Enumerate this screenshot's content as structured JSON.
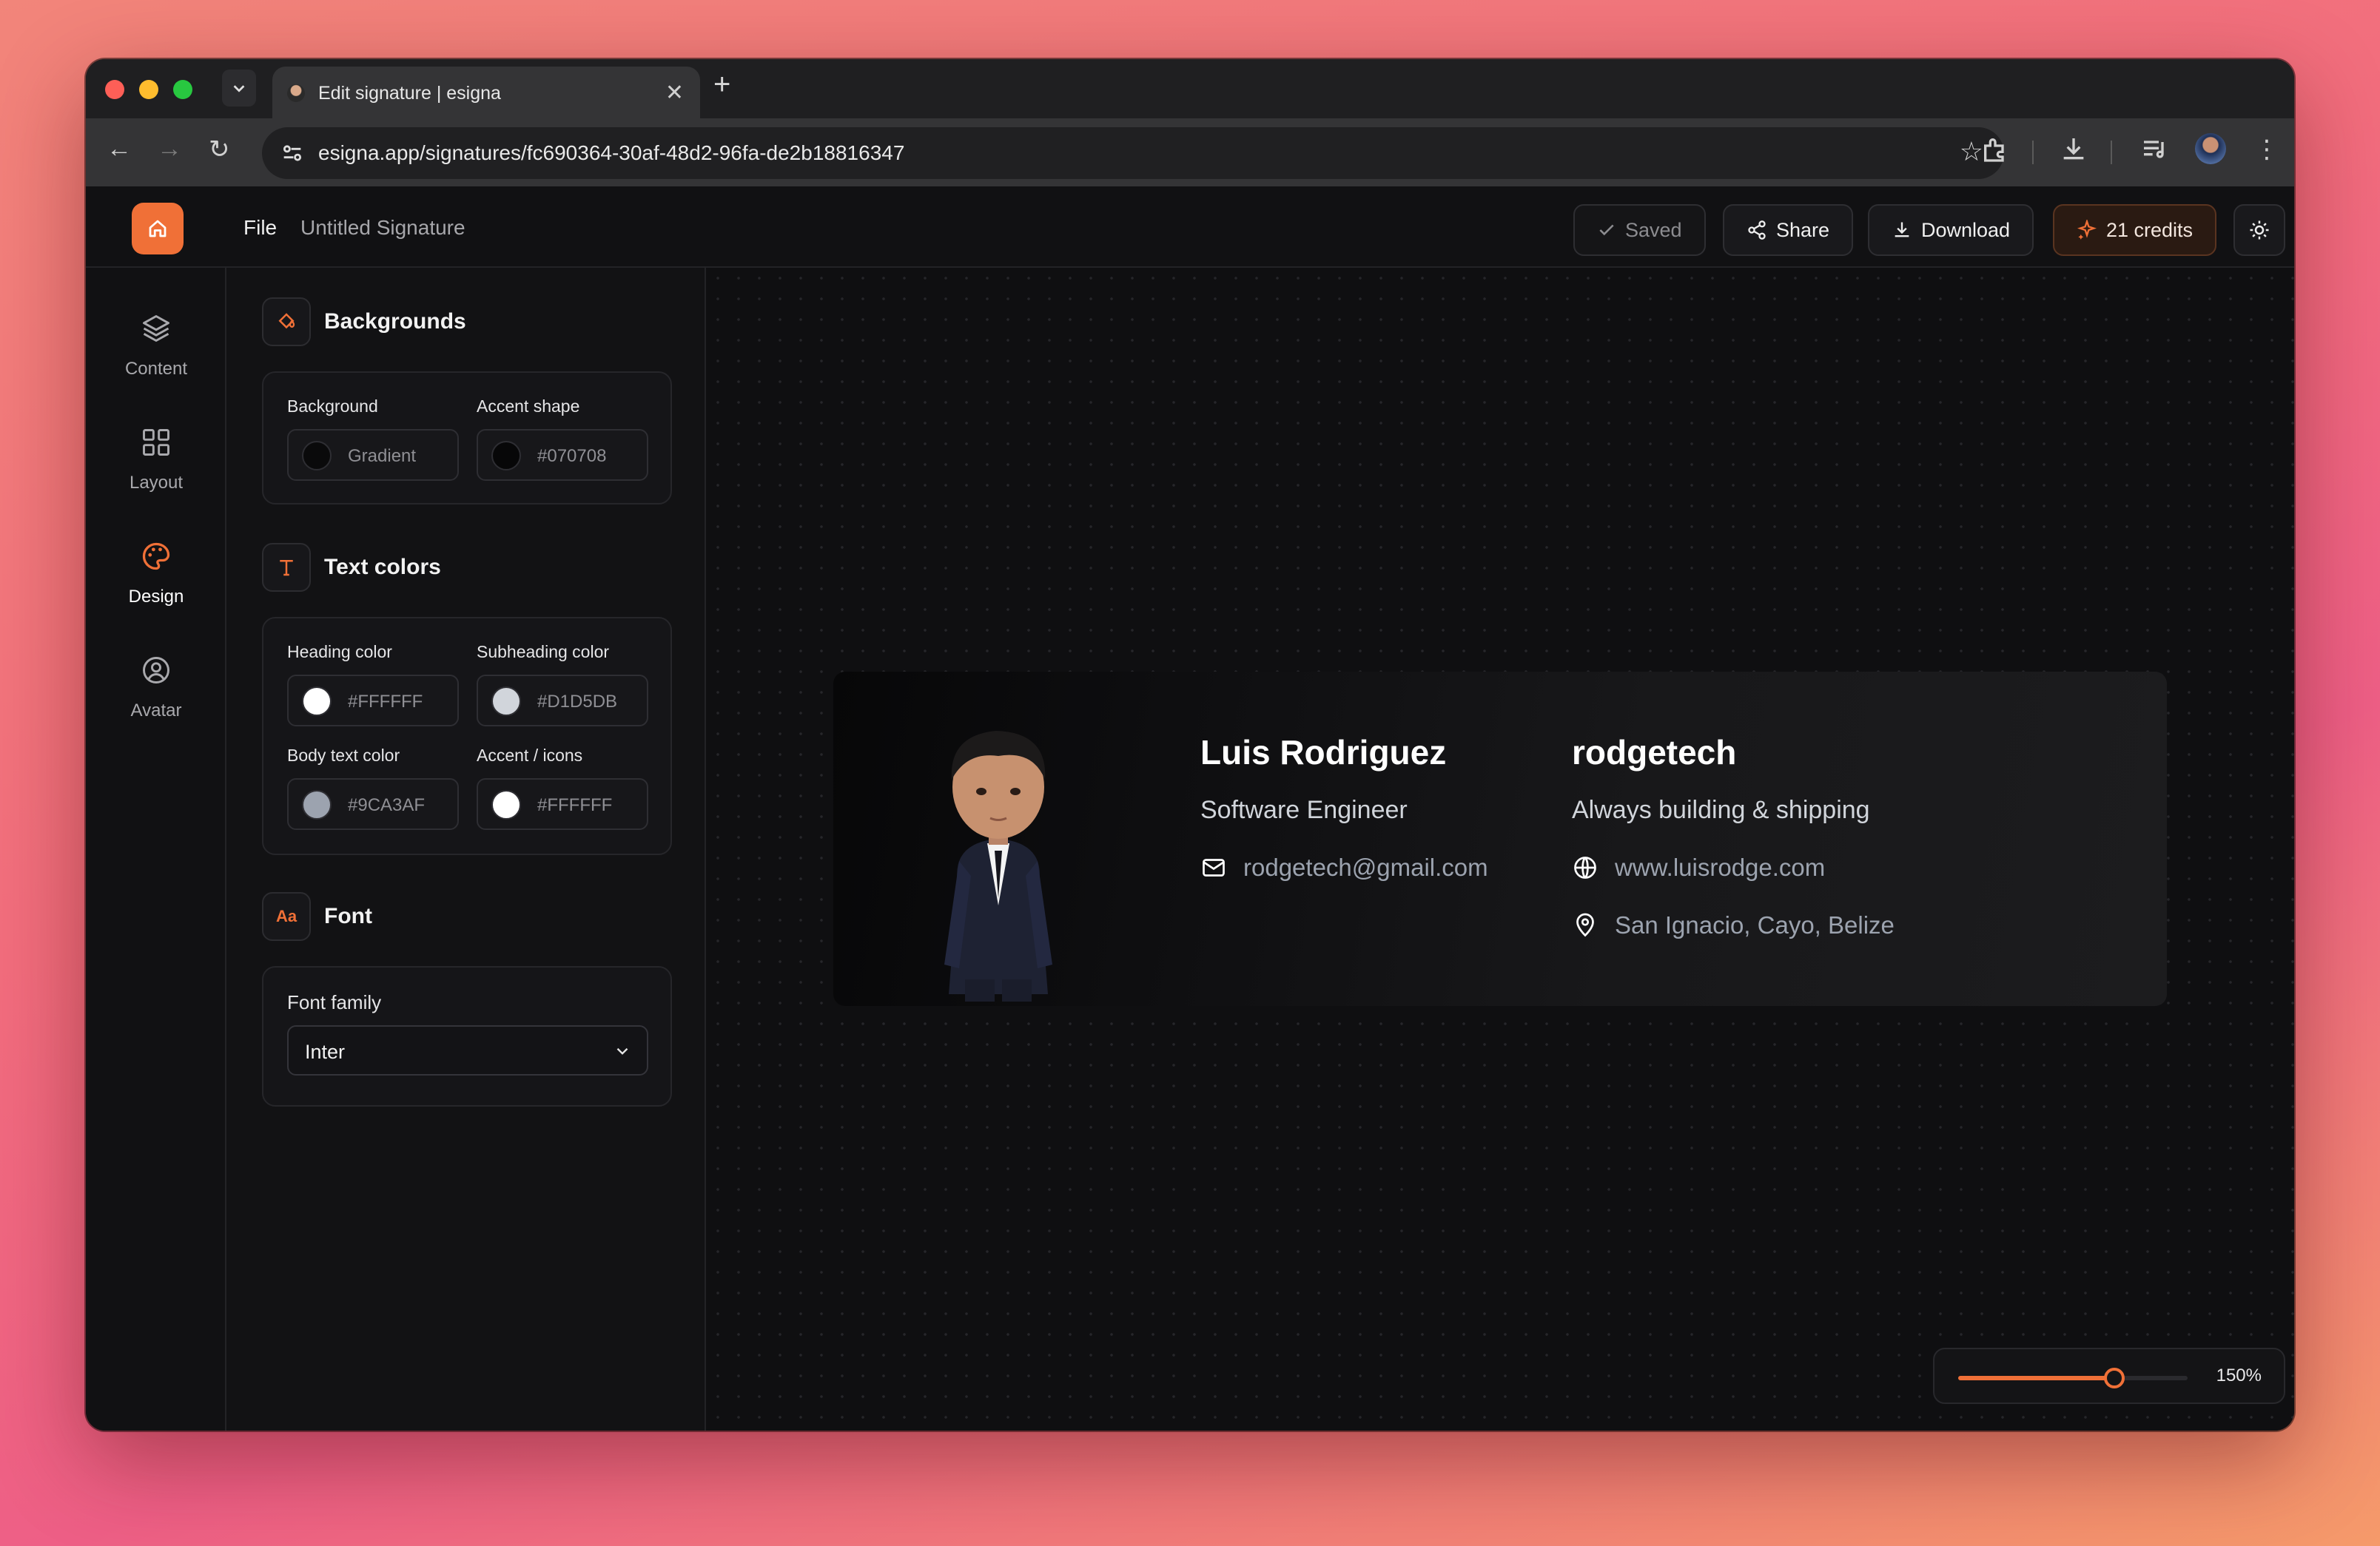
{
  "browser": {
    "tab_title": "Edit signature | esigna",
    "url": "esigna.app/signatures/fc690364-30af-48d2-96fa-de2b18816347"
  },
  "header": {
    "file_menu": "File",
    "document_name": "Untitled Signature",
    "saved_label": "Saved",
    "share_label": "Share",
    "download_label": "Download",
    "credits_label": "21 credits",
    "accent_color": "#f07037"
  },
  "rail": {
    "items": [
      {
        "label": "Content",
        "icon": "layers-icon"
      },
      {
        "label": "Layout",
        "icon": "grid-icon"
      },
      {
        "label": "Design",
        "icon": "palette-icon",
        "active": true
      },
      {
        "label": "Avatar",
        "icon": "user-circle-icon"
      }
    ]
  },
  "panel": {
    "backgrounds": {
      "title": "Backgrounds",
      "background_label": "Background",
      "background_value": "Gradient",
      "accent_label": "Accent shape",
      "accent_value": "#070708"
    },
    "text_colors": {
      "title": "Text colors",
      "heading_label": "Heading color",
      "heading_value": "#FFFFFF",
      "subheading_label": "Subheading color",
      "subheading_value": "#D1D5DB",
      "body_label": "Body text color",
      "body_value": "#9CA3AF",
      "accent_label": "Accent / icons",
      "accent_value": "#FFFFFF"
    },
    "font": {
      "title": "Font",
      "icon_text": "Aa",
      "family_label": "Font family",
      "family_value": "Inter"
    }
  },
  "signature": {
    "name": "Luis Rodriguez",
    "role": "Software Engineer",
    "email": "rodgetech@gmail.com",
    "company": "rodgetech",
    "tagline": "Always building & shipping",
    "website": "www.luisrodge.com",
    "location": "San Ignacio, Cayo, Belize"
  },
  "zoom": {
    "label": "150%",
    "fraction": 0.68
  }
}
